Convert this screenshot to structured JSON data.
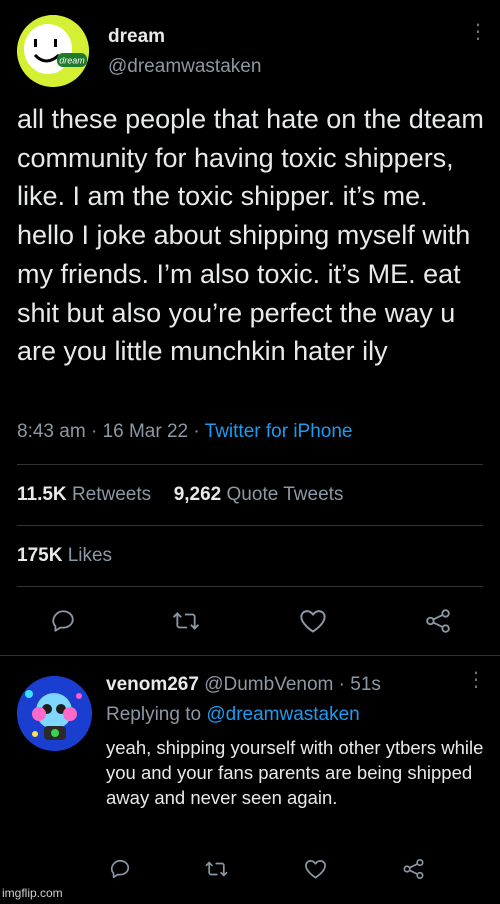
{
  "tweet": {
    "author_name": "dream",
    "author_handle": "@dreamwastaken",
    "avatar_label": "dream",
    "text": "all these people that hate on the dteam community for having toxic shippers, like. I am the toxic shipper. it’s me. hello I joke about shipping myself with my friends. I’m also toxic. it’s ME. eat shit but also you’re perfect the way u are you little munchkin hater ily",
    "time": "8:43 am",
    "date": "16 Mar 22",
    "separator": "·",
    "source": "Twitter for iPhone",
    "retweets_count": "11.5K",
    "retweets_label": "Retweets",
    "quotes_count": "9,262",
    "quotes_label": "Quote Tweets",
    "likes_count": "175K",
    "likes_label": "Likes"
  },
  "actions": {
    "icons": [
      "reply-icon",
      "retweet-icon",
      "like-icon",
      "share-icon"
    ]
  },
  "reply": {
    "author_name": "venom267",
    "author_handle": "@DumbVenom",
    "time": "51s",
    "separator": "·",
    "replying_prefix": "Replying to",
    "replying_to": "@dreamwastaken",
    "text": "yeah, shipping yourself with other ytbers while you and your fans parents are being shipped away and never seen again."
  },
  "watermark": "imgflip.com",
  "colors": {
    "background": "#000000",
    "text": "#e7e9ea",
    "secondary": "#8b98a5",
    "link": "#1d9bf0",
    "divider": "#2f3336",
    "dream_green": "#d5f034"
  }
}
